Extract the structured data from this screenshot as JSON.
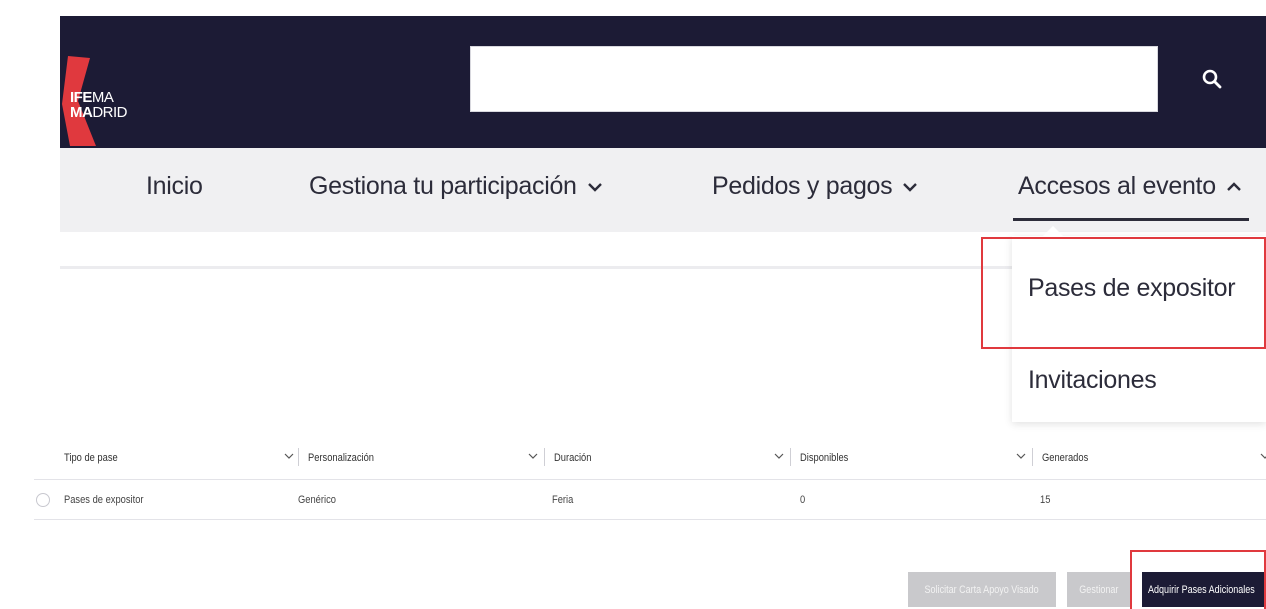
{
  "brand": {
    "line1_bold": "IFE",
    "line1_thin": "MA",
    "line2_bold": "MA",
    "line2_thin": "DRID",
    "accent_color": "#e0393e",
    "header_color": "#1c1b35"
  },
  "search": {
    "placeholder": "",
    "value": "",
    "icon": "search-icon"
  },
  "nav": {
    "items": [
      {
        "label": "Inicio",
        "icon": ""
      },
      {
        "label": "Gestiona tu participación",
        "icon": "chevron-down-icon"
      },
      {
        "label": "Pedidos y pagos",
        "icon": "chevron-down-icon"
      },
      {
        "label": "Accesos al evento",
        "icon": "chevron-up-icon"
      }
    ]
  },
  "dropdown": {
    "items": [
      {
        "label": "Pases de expositor"
      },
      {
        "label": "Invitaciones"
      }
    ]
  },
  "table": {
    "columns": [
      "Tipo de pase",
      "Personalización",
      "Duración",
      "Disponibles",
      "Generados"
    ],
    "rows": [
      {
        "cells": [
          "Pases de expositor",
          "Genérico",
          "Feria",
          "0",
          "15"
        ]
      }
    ]
  },
  "actions": {
    "request_letter": "Solicitar Carta Apoyo Visado",
    "manage": "Gestionar",
    "acquire": "Adquirir Pases Adicionales"
  }
}
